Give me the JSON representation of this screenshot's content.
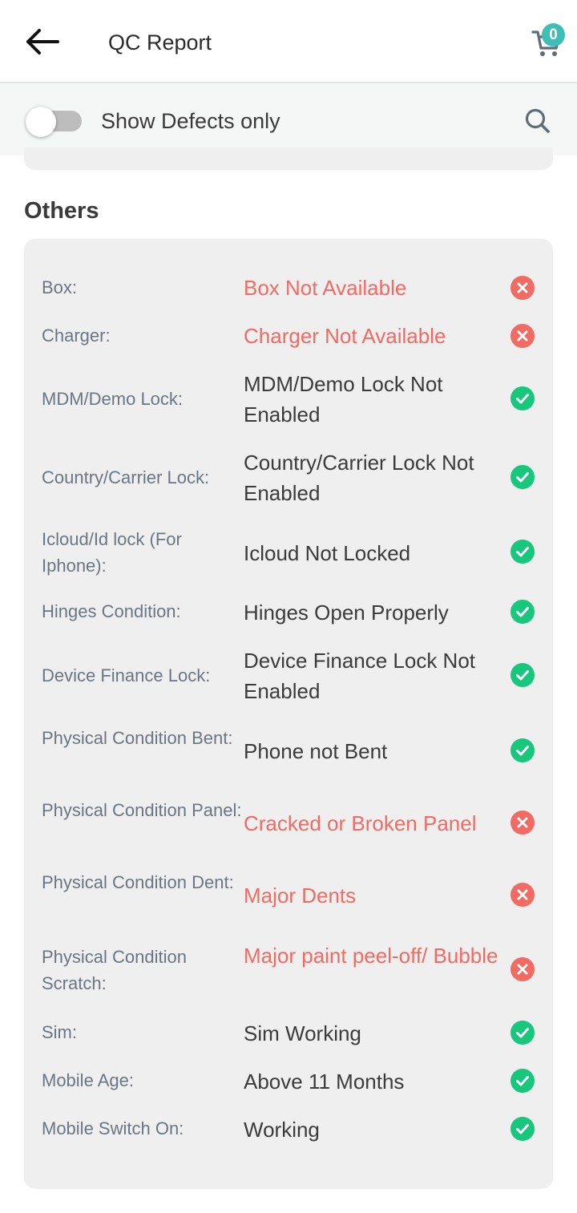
{
  "header": {
    "title": "QC Report",
    "cart_count": "0"
  },
  "filter": {
    "toggle_label": "Show Defects only",
    "toggle_on": false
  },
  "section": {
    "title": "Others"
  },
  "colors": {
    "ok": "#16c77c",
    "defect": "#f26b62",
    "badge": "#3dbfb8"
  },
  "rows": [
    {
      "label": "Box:",
      "value": "Box Not Available",
      "status": "defect"
    },
    {
      "label": "Charger:",
      "value": "Charger Not Available",
      "status": "defect"
    },
    {
      "label": "MDM/Demo Lock:",
      "value": "MDM/Demo Lock Not Enabled",
      "status": "ok"
    },
    {
      "label": "Country/Carrier Lock:",
      "value": "Country/Carrier Lock Not Enabled",
      "status": "ok"
    },
    {
      "label": "Icloud/Id lock (For Iphone):",
      "value": "Icloud Not Locked",
      "status": "ok"
    },
    {
      "label": "Hinges Condition:",
      "value": "Hinges Open Properly",
      "status": "ok"
    },
    {
      "label": "Device Finance Lock:",
      "value": "Device Finance Lock Not Enabled",
      "status": "ok"
    },
    {
      "label": "Physical Condition Bent:",
      "value": "Phone not Bent",
      "status": "ok"
    },
    {
      "label": "Physical Condition Panel:",
      "value": "Cracked or Broken Panel",
      "status": "defect"
    },
    {
      "label": "Physical Condition Dent:",
      "value": "Major Dents",
      "status": "defect"
    },
    {
      "label": "Physical Condition Scratch:",
      "value": "Major paint peel-off/ Bubble",
      "status": "defect"
    },
    {
      "label": "Sim:",
      "value": "Sim Working",
      "status": "ok"
    },
    {
      "label": "Mobile Age:",
      "value": "Above 11 Months",
      "status": "ok"
    },
    {
      "label": "Mobile Switch On:",
      "value": "Working",
      "status": "ok"
    }
  ]
}
